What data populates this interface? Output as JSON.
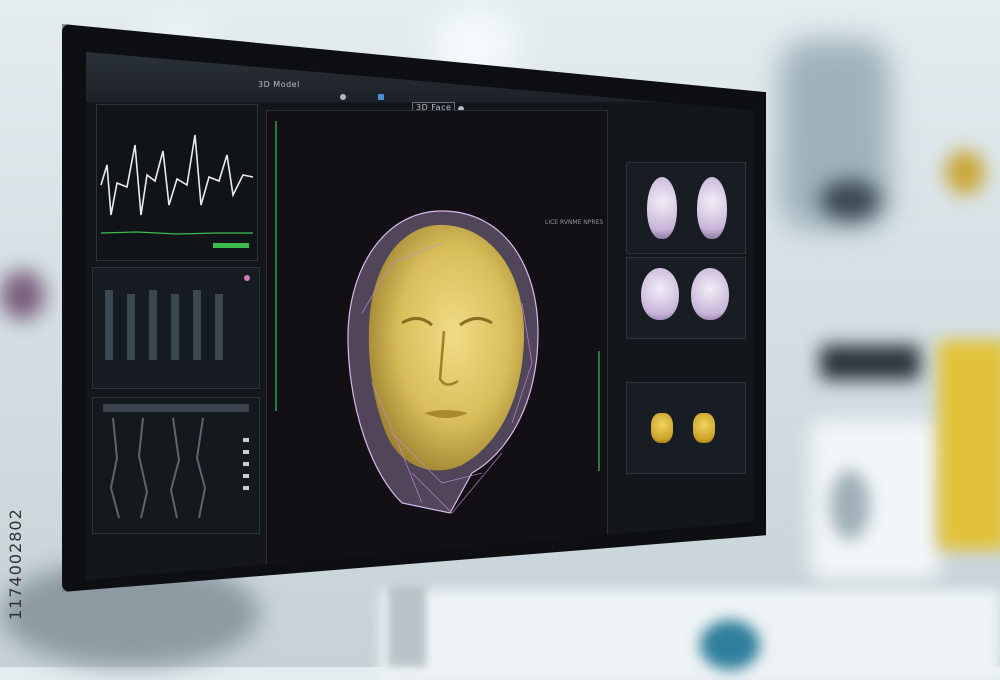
{
  "scene": {
    "kind": "medical-monitor-photo",
    "watermark_id": "1174002802"
  },
  "monitor": {
    "title_text": "3D Model",
    "top_center_text": "3D Face",
    "toolbar_icons": [
      "circle-icon",
      "square-icon",
      "gear-icon",
      "folder-icon"
    ],
    "colors": {
      "screen_bg": "#13171c",
      "face_mesh": "#d7b9e8",
      "face_skin": "#e6d06e",
      "ruler_green": "#2d8d4a"
    }
  },
  "viewport": {
    "side_readout": "LICE RVNME NPRES",
    "model": "3d-face-mesh"
  },
  "right_panels": {
    "brain_views": 4,
    "skull_views": 2
  }
}
